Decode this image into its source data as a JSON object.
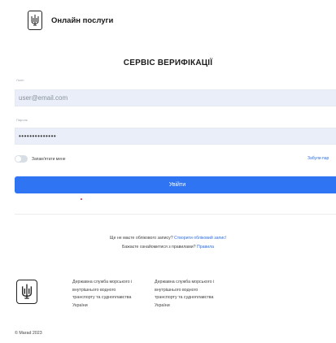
{
  "header": {
    "title": "Онлайн послуги"
  },
  "main": {
    "title": "СЕРВІС ВЕРИФІКАЦІЇ",
    "login_label": "Логін",
    "login_placeholder": "user@email.com",
    "password_label": "Пароль",
    "password_value": "••••••••••••••",
    "remember_label": "Запам'ятати мене",
    "forgot_link": "Забули пар",
    "submit_label": "Увійти"
  },
  "registration": {
    "question": "Ще не маєте облікового запису?",
    "create_link": "Створити обліковий запис!",
    "rules_question": "Бажаєте ознайомитися з правилами?",
    "rules_link": "Правила"
  },
  "footer": {
    "col1_lines": [
      "Державна служба морського і",
      "внутрішнього водного",
      "транспорту та судноплавства",
      "України"
    ],
    "col2_lines": [
      "Державна служба морського і",
      "внутрішнього водного",
      "транспорту та судноплавства",
      "України"
    ],
    "copyright": "© Marad 2023"
  },
  "colors": {
    "accent": "#2f74f3",
    "input_bg": "#e9eef8",
    "link": "#2f6fe0"
  },
  "icons": {
    "header_logo": "trident-emblem-icon",
    "footer_logo": "trident-emblem-icon"
  }
}
